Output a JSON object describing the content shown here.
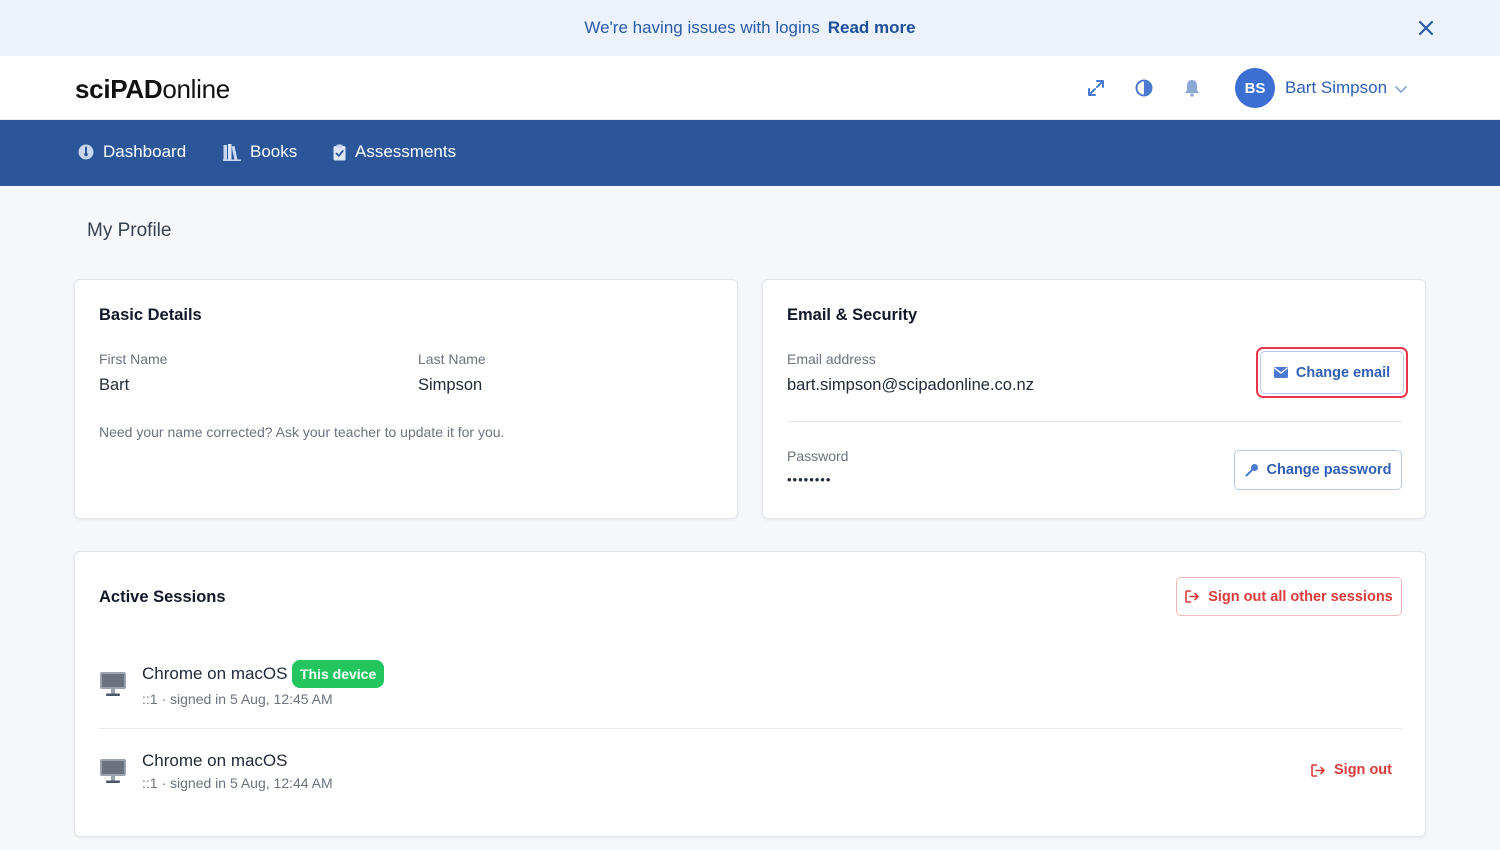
{
  "banner": {
    "message": "We're having issues with logins",
    "link_label": "Read more"
  },
  "header": {
    "logo_bold": "sciPAD",
    "logo_rest": "online",
    "user": {
      "initials": "BS",
      "name": "Bart Simpson"
    }
  },
  "nav": {
    "items": [
      {
        "label": "Dashboard",
        "icon": "dashboard-icon"
      },
      {
        "label": "Books",
        "icon": "books-icon"
      },
      {
        "label": "Assessments",
        "icon": "clipboard-icon"
      }
    ]
  },
  "page": {
    "title": "My Profile"
  },
  "basic_details": {
    "title": "Basic Details",
    "first_name_label": "First Name",
    "first_name": "Bart",
    "last_name_label": "Last Name",
    "last_name": "Simpson",
    "help": "Need your name corrected? Ask your teacher to update it for you."
  },
  "email_security": {
    "title": "Email & Security",
    "email_label": "Email address",
    "email": "bart.simpson@scipadonline.co.nz",
    "change_email_label": "Change email",
    "password_label": "Password",
    "password": "••••••••",
    "change_password_label": "Change password"
  },
  "sessions": {
    "title": "Active Sessions",
    "sign_out_all_label": "Sign out all other sessions",
    "items": [
      {
        "name": "Chrome on macOS",
        "meta": "::1 · signed in 5 Aug, 12:45 AM",
        "badge": "This device"
      },
      {
        "name": "Chrome on macOS",
        "meta": "::1 · signed in 5 Aug, 12:44 AM",
        "action": "Sign out"
      }
    ]
  },
  "colors": {
    "brand_blue": "#2b579a",
    "accent_blue": "#2f5fb5",
    "danger": "#dc3b3b",
    "success": "#22c55e",
    "highlight": "#e5364b"
  }
}
